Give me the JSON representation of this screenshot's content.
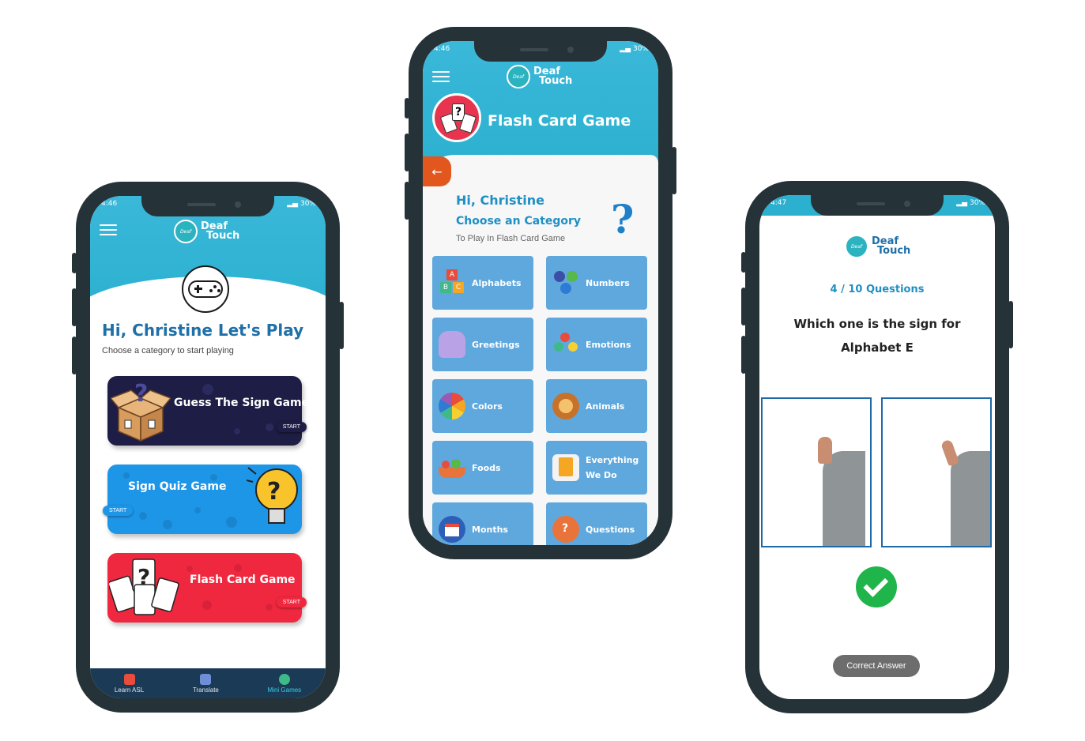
{
  "status": {
    "time1": "4:46",
    "time2": "4:46",
    "time3": "4:47",
    "battery": "30%"
  },
  "logo": {
    "line1": "Deaf",
    "line2": "Touch",
    "badge": "Deaf Touch"
  },
  "home": {
    "greeting": "Hi, Christine Let's Play",
    "subtitle": "Choose a category to start playing",
    "games": [
      {
        "title": "Guess The Sign Game",
        "start": "START",
        "color": "#1d1d45"
      },
      {
        "title": "Sign Quiz Game",
        "start": "START",
        "color": "#1e96e8"
      },
      {
        "title": "Flash Card Game",
        "start": "START",
        "color": "#f0283f"
      }
    ],
    "nav": [
      {
        "label": "Learn ASL",
        "icon": "book-icon"
      },
      {
        "label": "Translate",
        "icon": "translate-icon"
      },
      {
        "label": "Mini Games",
        "icon": "globe-icon"
      }
    ]
  },
  "flash": {
    "title": "Flash Card Game",
    "greeting": "Hi, Christine",
    "choose": "Choose an Category",
    "sub": "To Play In Flash Card Game",
    "back_icon": "arrow-left-icon",
    "categories": [
      {
        "label": "Alphabets",
        "line2": ""
      },
      {
        "label": "Numbers",
        "line2": ""
      },
      {
        "label": "Greetings",
        "line2": ""
      },
      {
        "label": "Emotions",
        "line2": ""
      },
      {
        "label": "Colors",
        "line2": ""
      },
      {
        "label": "Animals",
        "line2": ""
      },
      {
        "label": "Foods",
        "line2": ""
      },
      {
        "label": "Everything",
        "line2": "We Do"
      },
      {
        "label": "Months",
        "line2": ""
      },
      {
        "label": "Questions",
        "line2": ""
      }
    ]
  },
  "quiz": {
    "progress": "4 / 10 Questions",
    "question_line1": "Which one is the sign for",
    "question_line2": "Alphabet E",
    "result": "Correct Answer",
    "result_icon": "checkmark-circle-icon"
  },
  "colors": {
    "brand_blue": "#1f6fa8",
    "header_teal": "#2cb0cf",
    "category_tile": "#5fa8dd",
    "success_green": "#1fb54b",
    "back_orange": "#e2571e"
  }
}
